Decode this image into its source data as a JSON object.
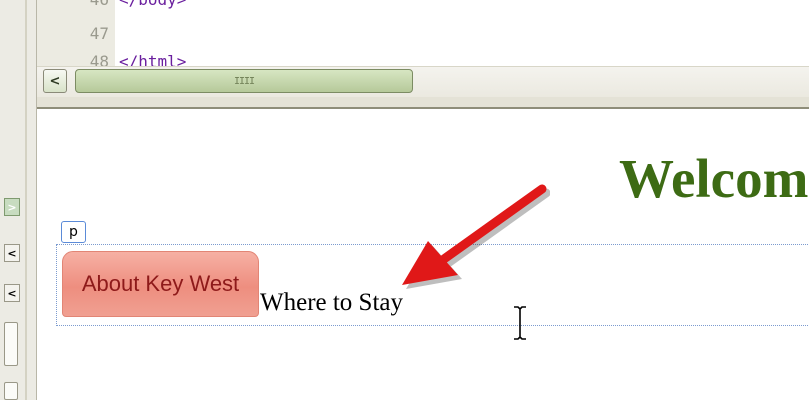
{
  "code_view": {
    "lines": [
      {
        "number": "46",
        "code": "</body>"
      },
      {
        "number": "47",
        "code": ""
      },
      {
        "number": "48",
        "code": "</html>"
      }
    ]
  },
  "scrollbar": {
    "left_arrow": "<",
    "thumb_grip": "IIII"
  },
  "left_panel": {
    "buttons": [
      ">",
      "<",
      "<"
    ]
  },
  "design_view": {
    "heading": "Welcome",
    "tag_label": "p",
    "about_button_label": "About Key West",
    "link_text": "Where to Stay"
  },
  "colors": {
    "heading": "#3d6b14",
    "button_fill": "#ee8e7f",
    "button_text": "#8e1a1a",
    "arrow": "#e01818",
    "code_tag": "#6a1f9e"
  }
}
